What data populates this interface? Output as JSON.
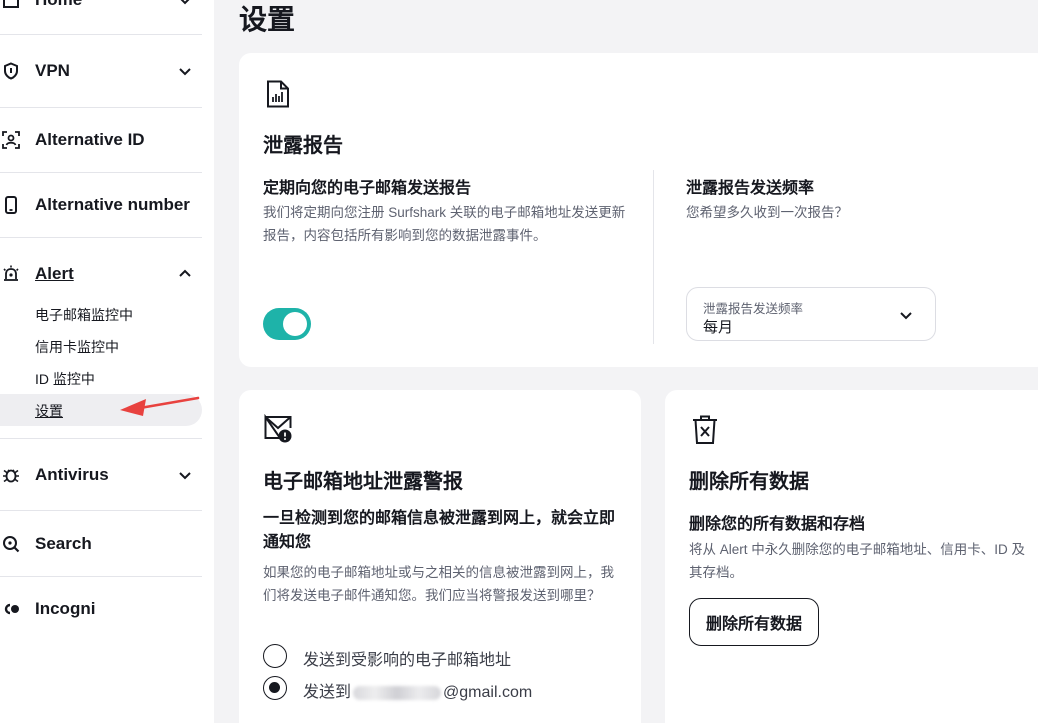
{
  "sidebar": {
    "items": [
      {
        "label": "Home",
        "icon": "home-icon"
      },
      {
        "label": "VPN",
        "icon": "shield-icon"
      },
      {
        "label": "Alternative ID",
        "icon": "alternative-id-icon"
      },
      {
        "label": "Alternative number",
        "icon": "phone-icon"
      },
      {
        "label": "Alert",
        "icon": "alert-bell-icon"
      },
      {
        "label": "Antivirus",
        "icon": "bug-icon"
      },
      {
        "label": "Search",
        "icon": "search-icon"
      },
      {
        "label": "Incogni",
        "icon": "incogni-icon"
      }
    ],
    "alert_sub": [
      "电子邮箱监控中",
      "信用卡监控中",
      "ID 监控中",
      "设置"
    ]
  },
  "page": {
    "title": "设置"
  },
  "report_card": {
    "title": "泄露报告",
    "left": {
      "title": "定期向您的电子邮箱发送报告",
      "desc": "我们将定期向您注册 Surfshark 关联的电子邮箱地址发送更新报告，内容包括所有影响到您的数据泄露事件。",
      "toggle_on": true
    },
    "right": {
      "title": "泄露报告发送频率",
      "desc": "您希望多久收到一次报告？",
      "select_label": "泄露报告发送频率",
      "select_value": "每月"
    }
  },
  "email_card": {
    "title": "电子邮箱地址泄露警报",
    "subtitle": "一旦检测到您的邮箱信息被泄露到网上，就会立即通知您",
    "desc": "如果您的电子邮箱地址或与之相关的信息被泄露到网上，我们将发送电子邮件通知您。我们应当将警报发送到哪里？",
    "options": [
      {
        "label": "发送到受影响的电子邮箱地址",
        "checked": false
      },
      {
        "prefix": "发送到",
        "suffix": "@gmail.com",
        "checked": true
      }
    ]
  },
  "delete_card": {
    "title": "删除所有数据",
    "subtitle": "删除您的所有数据和存档",
    "desc": "将从 Alert 中永久删除您的电子邮箱地址、信用卡、ID 及其存档。",
    "button": "删除所有数据"
  },
  "colors": {
    "accent": "#1eb3a9",
    "annotation_arrow": "#e8423f"
  }
}
